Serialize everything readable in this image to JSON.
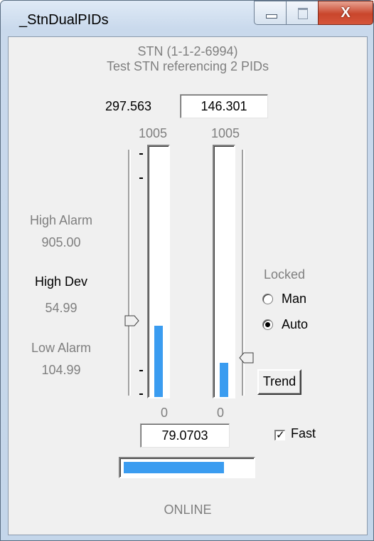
{
  "window": {
    "title": "_StnDualPIDs",
    "minimize_icon": "minimize-icon",
    "maximize_icon": "maximize-icon",
    "close_icon": "close-icon",
    "close_glyph": "X"
  },
  "station": {
    "id": "STN (1-1-2-6994)",
    "description": "Test STN referencing 2 PIDs"
  },
  "pv_value": "297.563",
  "setpoint_value": "146.301",
  "scale": {
    "left_max": "1005",
    "right_max": "1005",
    "left_min": "0",
    "right_min": "0"
  },
  "alarms": {
    "high_alarm_label": "High Alarm",
    "high_alarm_value": "905.00",
    "high_dev_label": "High Dev",
    "high_dev_value": "54.99",
    "low_alarm_label": "Low Alarm",
    "low_alarm_value": "104.99"
  },
  "bars": {
    "left_fill_fraction": 0.29,
    "right_fill_fraction": 0.14,
    "left_slider_fraction": 0.3,
    "right_slider_fraction": 0.15
  },
  "mode": {
    "locked_label": "Locked",
    "man_label": "Man",
    "auto_label": "Auto",
    "selected": "Auto"
  },
  "trend_label": "Trend",
  "output_value": "79.0703",
  "fast_label": "Fast",
  "fast_checked": true,
  "output_bar_fraction": 0.79,
  "status": "ONLINE",
  "colors": {
    "bar_fill": "#3a9cf0",
    "dialog_bg": "#f0f0f0"
  }
}
